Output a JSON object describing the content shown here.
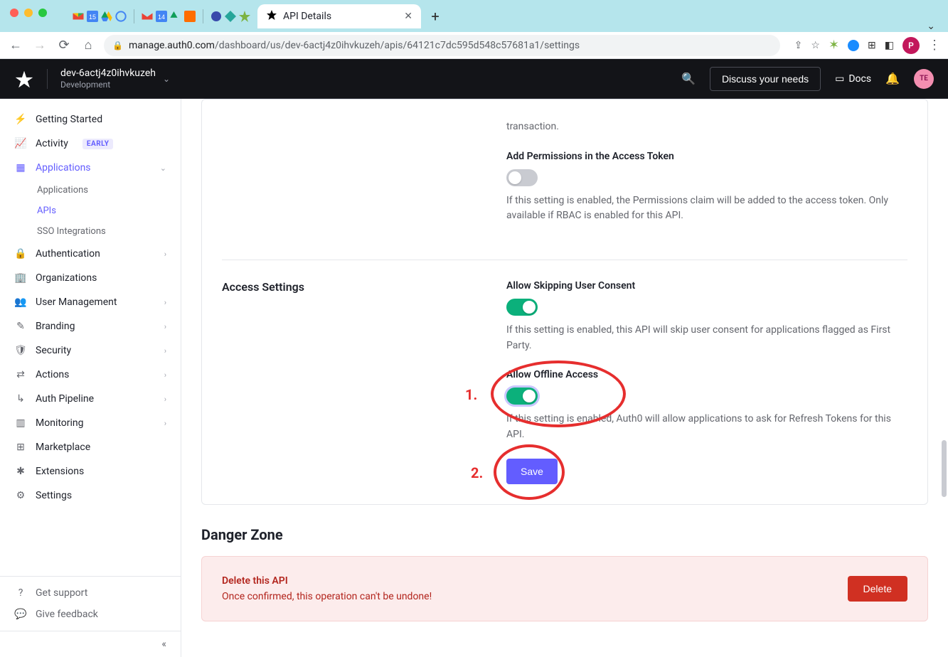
{
  "chrome": {
    "active_tab_title": "API Details",
    "url_host": "manage.auth0.com",
    "url_path": "/dashboard/us/dev-6actj4z0ihvkuzeh/apis/64121c7dc595d548c57681a1/settings"
  },
  "header": {
    "tenant_name": "dev-6actj4z0ihvkuzeh",
    "tenant_env": "Development",
    "discuss_label": "Discuss your needs",
    "docs_label": "Docs",
    "avatar_initials": "TE"
  },
  "sidebar": {
    "items": [
      {
        "label": "Getting Started",
        "icon": "bolt"
      },
      {
        "label": "Activity",
        "icon": "activity",
        "badge": "EARLY"
      },
      {
        "label": "Applications",
        "icon": "layers",
        "active": true,
        "expanded": true,
        "children": [
          {
            "label": "Applications"
          },
          {
            "label": "APIs",
            "active": true
          },
          {
            "label": "SSO Integrations"
          }
        ]
      },
      {
        "label": "Authentication",
        "icon": "lock",
        "hasChildren": true
      },
      {
        "label": "Organizations",
        "icon": "building"
      },
      {
        "label": "User Management",
        "icon": "users",
        "hasChildren": true
      },
      {
        "label": "Branding",
        "icon": "brush",
        "hasChildren": true
      },
      {
        "label": "Security",
        "icon": "shield",
        "hasChildren": true
      },
      {
        "label": "Actions",
        "icon": "flow",
        "hasChildren": true
      },
      {
        "label": "Auth Pipeline",
        "icon": "pipeline",
        "hasChildren": true
      },
      {
        "label": "Monitoring",
        "icon": "bars",
        "hasChildren": true
      },
      {
        "label": "Marketplace",
        "icon": "grid"
      },
      {
        "label": "Extensions",
        "icon": "puzzle"
      },
      {
        "label": "Settings",
        "icon": "gear"
      }
    ],
    "support_label": "Get support",
    "feedback_label": "Give feedback"
  },
  "content": {
    "partial_desc_end": "transaction.",
    "perm_title": "Add Permissions in the Access Token",
    "perm_desc": "If this setting is enabled, the Permissions claim will be added to the access token. Only available if RBAC is enabled for this API.",
    "access_section": "Access Settings",
    "skip_title": "Allow Skipping User Consent",
    "skip_desc": "If this setting is enabled, this API will skip user consent for applications flagged as First Party.",
    "offline_title": "Allow Offline Access",
    "offline_desc": "If this setting is enabled, Auth0 will allow applications to ask for Refresh Tokens for this API.",
    "save_label": "Save",
    "danger_section": "Danger Zone",
    "danger_title": "Delete this API",
    "danger_msg": "Once confirmed, this operation can't be undone!",
    "delete_label": "Delete"
  },
  "annotations": {
    "n1": "1.",
    "n2": "2."
  }
}
